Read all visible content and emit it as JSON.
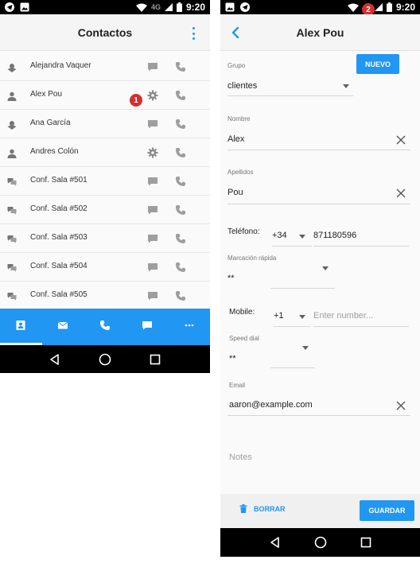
{
  "colors": {
    "accent": "#2196f3",
    "badge": "#d32f2f",
    "statusbar": "#000000"
  },
  "status_bar_left": {
    "icons": [
      "telegram-icon",
      "image-icon"
    ],
    "network": "4G",
    "time": "9:20"
  },
  "status_bar_right": {
    "icons": [
      "image-icon",
      "telegram-icon"
    ],
    "time": "9:20"
  },
  "contacts_screen": {
    "title": "Contactos",
    "contacts": [
      {
        "name": "Alejandra Vaquer",
        "avatar_icon": "group-icon",
        "action_icon": "chat-icon"
      },
      {
        "name": "Alex Pou",
        "avatar_icon": "person-icon",
        "action_icon": "gear-icon"
      },
      {
        "name": "Ana García",
        "avatar_icon": "group-icon",
        "action_icon": "chat-icon"
      },
      {
        "name": "Andres Colón",
        "avatar_icon": "person-icon",
        "action_icon": "gear-icon"
      },
      {
        "name": "Conf. Sala #501",
        "avatar_icon": "conference-icon",
        "action_icon": "chat-icon"
      },
      {
        "name": "Conf. Sala #502",
        "avatar_icon": "conference-icon",
        "action_icon": "chat-icon"
      },
      {
        "name": "Conf. Sala #503",
        "avatar_icon": "conference-icon",
        "action_icon": "chat-icon"
      },
      {
        "name": "Conf. Sala #504",
        "avatar_icon": "conference-icon",
        "action_icon": "chat-icon"
      },
      {
        "name": "Conf. Sala #505",
        "avatar_icon": "conference-icon",
        "action_icon": "chat-icon"
      }
    ],
    "tabs": [
      "contacts-icon",
      "mail-icon",
      "phone-icon",
      "chat-icon",
      "more-icon"
    ],
    "active_tab": 0
  },
  "badges": {
    "first": "1",
    "second": "2"
  },
  "edit_screen": {
    "title": "Alex Pou",
    "group_label": "Grupo",
    "group_value": "clientes",
    "new_button": "NUEVO",
    "first_name_label": "Nombre",
    "first_name_value": "Alex",
    "last_name_label": "Apellidos",
    "last_name_value": "Pou",
    "phone_label": "Teléfono:",
    "phone_prefix": "+34",
    "phone_number": "871180596",
    "speed_dial_label_1": "Marcación rápida",
    "speed_dial_value_1": "**",
    "mobile_label": "Mobile:",
    "mobile_prefix": "+1",
    "mobile_placeholder": "Enter number...",
    "speed_dial_label_2": "Speed dial",
    "speed_dial_value_2": "**",
    "email_label": "Email",
    "email_value": "aaron@example.com",
    "notes_placeholder": "Notes",
    "delete_button": "BORRAR",
    "save_button": "GUARDAR"
  }
}
